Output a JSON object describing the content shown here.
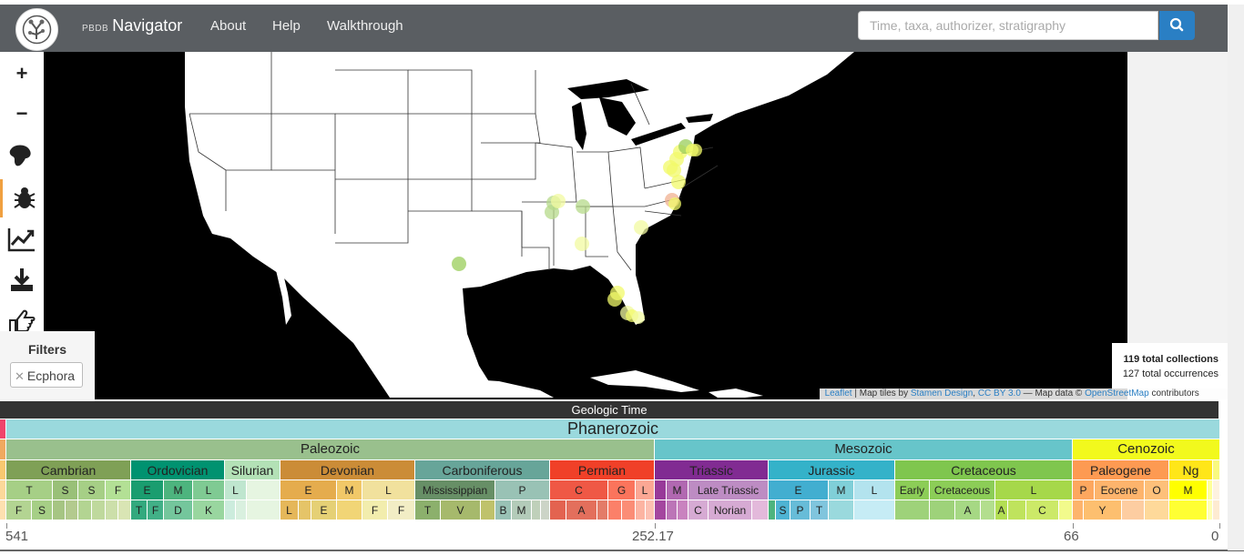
{
  "brand": {
    "prefix": "PBDB",
    "name": "Navigator"
  },
  "nav": {
    "links": [
      "About",
      "Help",
      "Walkthrough"
    ]
  },
  "search": {
    "placeholder": "Time, taxa, authorizer, stratigraphy",
    "button_icon": "search-icon"
  },
  "toolbar": {
    "tools": [
      "zoom-in-icon",
      "zoom-out-icon",
      "paleomap-icon",
      "taxa-browser-icon",
      "diversity-chart-icon",
      "download-icon",
      "pointer-icon"
    ],
    "zoom_in": "+",
    "zoom_out": "−"
  },
  "filters": {
    "title": "Filters",
    "items": [
      {
        "label": "Ecphora"
      }
    ]
  },
  "stats": {
    "collections_count": "119",
    "collections_text": "total collections",
    "occurrences_count": "127",
    "occurrences_text": "total occurrences"
  },
  "attribution": {
    "leaflet": "Leaflet",
    "tiles_text": " | Map tiles by ",
    "stamen": "Stamen Design",
    "comma": ", ",
    "license": "CC BY 3.0",
    "mapdata": " — Map data © ",
    "osm": "OpenStreetMap",
    "contributors": " contributors"
  },
  "timescale": {
    "header": "Geologic Time",
    "eon": "Phanerozoic",
    "eras": [
      "Paleozoic",
      "Mesozoic",
      "Cenozoic"
    ],
    "periods": [
      "Cambrian",
      "Ordovician",
      "Silurian",
      "Devonian",
      "Carboniferous",
      "Permian",
      "Triassic",
      "Jurassic",
      "Cretaceous",
      "Paleogene",
      "Ng"
    ],
    "epochs": [
      "T",
      "S",
      "S",
      "F",
      "E",
      "M",
      "L",
      "L",
      "E",
      "M",
      "L",
      "Mississippian",
      "P",
      "C",
      "G",
      "L",
      "M",
      "Late Triassic",
      "E",
      "M",
      "L",
      "Early",
      "Cretaceous",
      "L",
      "P",
      "Eocene",
      "O",
      "M"
    ],
    "stages": [
      "F",
      "S",
      "T",
      "F",
      "D",
      "K",
      "L",
      "E",
      "F",
      "F",
      "T",
      "V",
      "B",
      "M",
      "A",
      "C",
      "Norian",
      "S",
      "P",
      "T",
      "A",
      "A",
      "C",
      "Y"
    ],
    "axis": [
      "541",
      "252.17",
      "66",
      "0"
    ]
  },
  "colors": {
    "navbar": "#5a5e62",
    "accent": "#2a7fc4",
    "phanerozoic": "#9AD9DD",
    "paleozoic": "#99C08D",
    "mesozoic": "#67C5CA",
    "cenozoic": "#F2F91D"
  }
}
